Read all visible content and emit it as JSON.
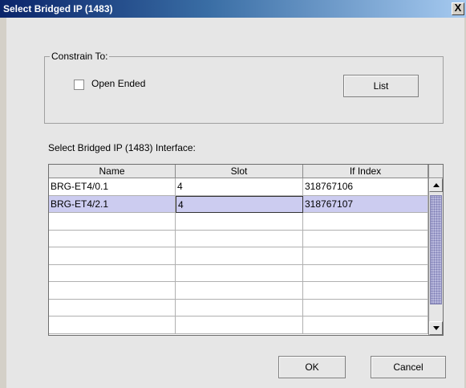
{
  "window": {
    "title": "Select Bridged IP (1483)",
    "close_label": "X"
  },
  "constrain": {
    "legend": "Constrain To:",
    "open_ended_label": "Open Ended",
    "open_ended_checked": false,
    "list_label": "List"
  },
  "table": {
    "label": "Select Bridged IP (1483) Interface:",
    "columns": [
      "Name",
      "Slot",
      "If Index"
    ],
    "rows": [
      [
        "BRG-ET4/0.1",
        "4",
        "318767106"
      ],
      [
        "BRG-ET4/2.1",
        "4",
        "318767107"
      ],
      [
        "",
        "",
        ""
      ],
      [
        "",
        "",
        ""
      ],
      [
        "",
        "",
        ""
      ],
      [
        "",
        "",
        ""
      ],
      [
        "",
        "",
        ""
      ],
      [
        "",
        "",
        ""
      ],
      [
        "",
        "",
        ""
      ]
    ],
    "selected_row": 1
  },
  "buttons": {
    "ok_label": "OK",
    "cancel_label": "Cancel"
  }
}
